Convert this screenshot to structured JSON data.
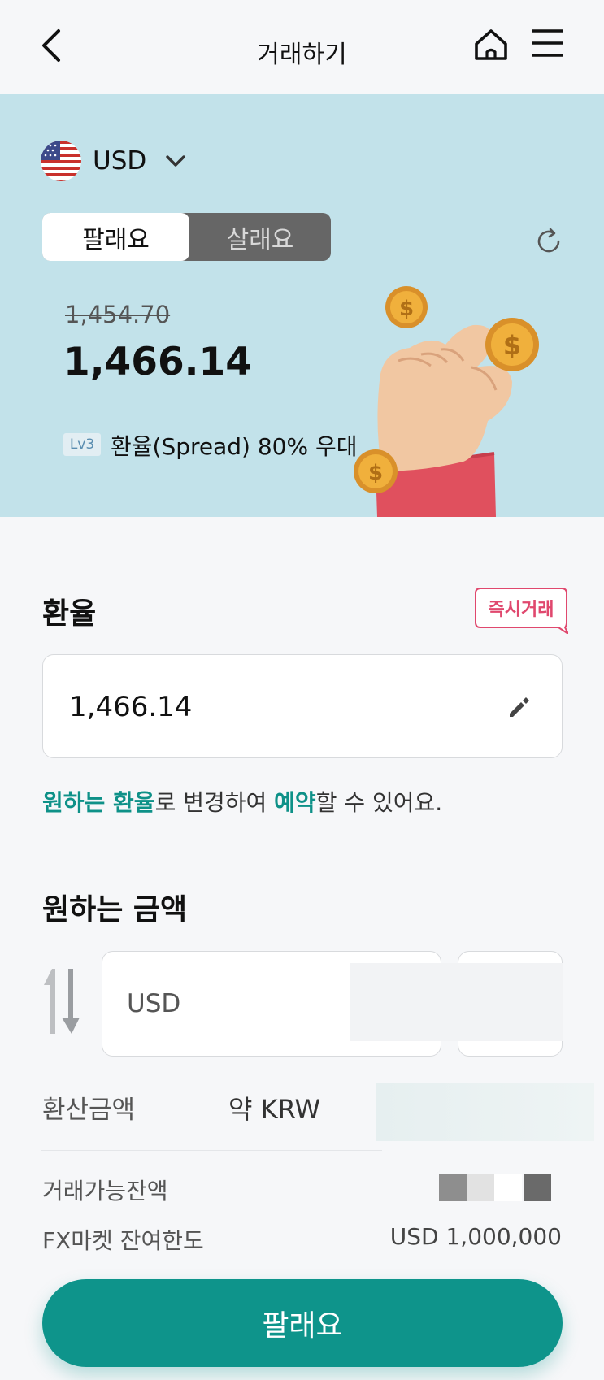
{
  "header": {
    "title": "거래하기",
    "back_icon": "chevron-left-icon",
    "home_icon": "home-icon",
    "menu_icon": "hamburger-menu-icon"
  },
  "hero": {
    "currency": "USD",
    "flag": "us-flag-icon",
    "tabs": [
      {
        "label": "팔래요",
        "selected": true
      },
      {
        "label": "살래요",
        "selected": false
      }
    ],
    "old_rate": "1,454.70",
    "current_rate": "1,466.14",
    "level_badge": "Lv3",
    "spread_text": "환율(Spread) 80% 우대",
    "background_color": "#c2e2ea"
  },
  "rate_section": {
    "heading": "환율",
    "instant_badge": "즉시거래",
    "input_value": "1,466.14",
    "hint": {
      "part1": "원하는 환율",
      "part2": "로 변경하여 ",
      "part3": "예약",
      "part4": "할 수 있어요."
    }
  },
  "amount_section": {
    "heading": "원하는 금액",
    "input_currency": "USD",
    "converted_label": "환산금액",
    "converted_currency": "약 KRW",
    "balance_label": "거래가능잔액",
    "limit_label": "FX마켓 잔여한도",
    "limit_value": "USD 1,000,000"
  },
  "action": {
    "button_label": "팔래요",
    "color": "#0e948b"
  },
  "colors": {
    "accent": "#0e9188",
    "badge_pink": "#e0486e"
  }
}
